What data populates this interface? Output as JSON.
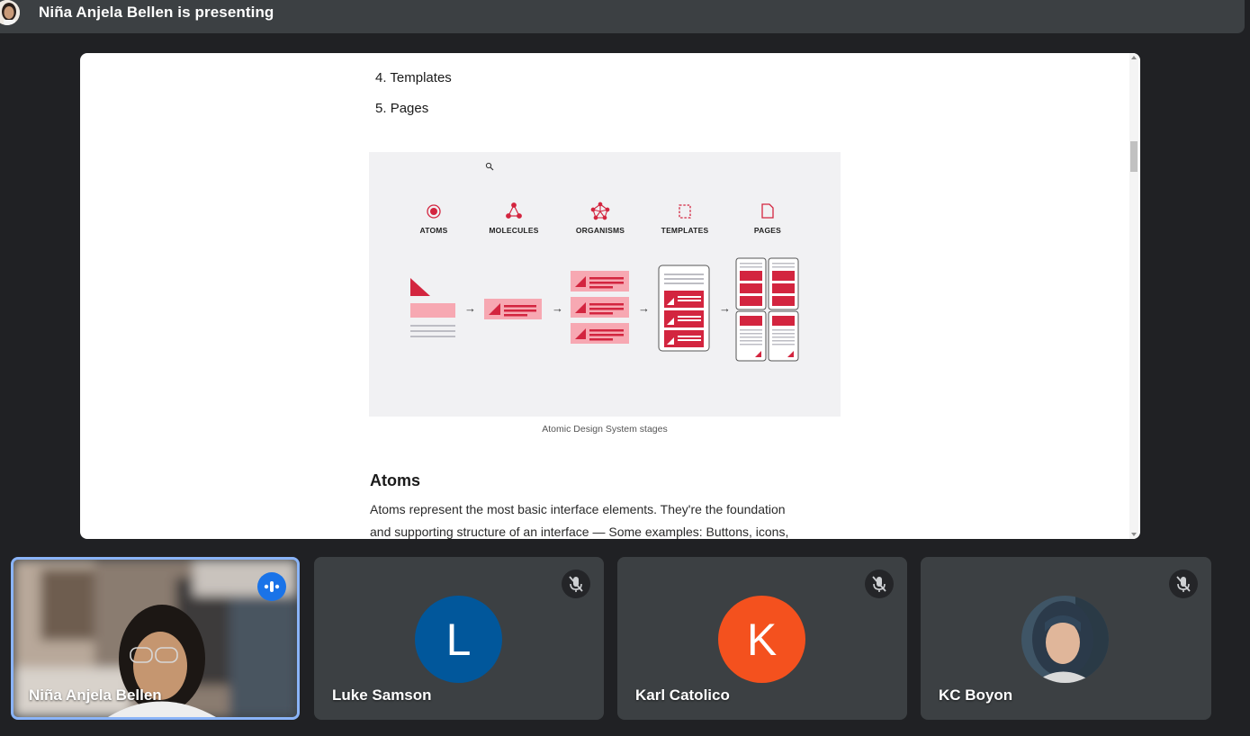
{
  "presenting_bar": {
    "title": "Niña Anjela Bellen is presenting"
  },
  "shared_document": {
    "list_items": [
      {
        "number": "4.",
        "label": "Templates"
      },
      {
        "number": "5.",
        "label": "Pages"
      }
    ],
    "figure": {
      "stages": [
        "ATOMS",
        "MOLECULES",
        "ORGANISMS",
        "TEMPLATES",
        "PAGES"
      ],
      "accent_color": "#d3253f",
      "light_color": "#f7a8b2"
    },
    "caption": "Atomic Design System stages",
    "heading": "Atoms",
    "paragraph_line1": "Atoms represent the most basic interface elements. They're the foundation",
    "paragraph_line2": "and supporting structure of an interface — Some examples: Buttons, icons,"
  },
  "participants": [
    {
      "name": "Niña Anjela Bellen",
      "type": "video",
      "speaking": true
    },
    {
      "name": "Luke Samson",
      "initial": "L",
      "avatar_color": "#01579b",
      "muted": true
    },
    {
      "name": "Karl Catolico",
      "initial": "K",
      "avatar_color": "#f4511e",
      "muted": true
    },
    {
      "name": "KC Boyon",
      "type": "photo",
      "muted": true
    }
  ]
}
